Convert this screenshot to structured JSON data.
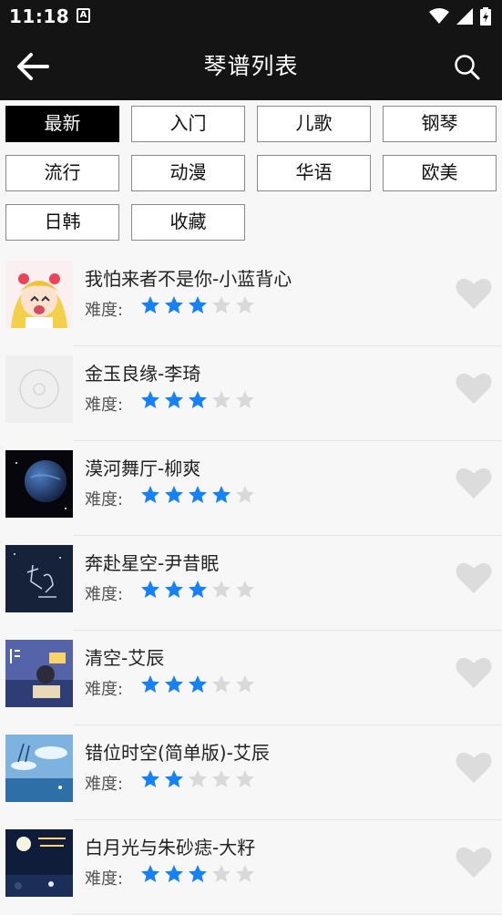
{
  "status": {
    "time": "11:18",
    "notif_icon": "A"
  },
  "appbar": {
    "title": "琴谱列表"
  },
  "chips": [
    {
      "label": "最新",
      "active": true
    },
    {
      "label": "入门",
      "active": false
    },
    {
      "label": "儿歌",
      "active": false
    },
    {
      "label": "钢琴",
      "active": false
    },
    {
      "label": "流行",
      "active": false
    },
    {
      "label": "动漫",
      "active": false
    },
    {
      "label": "华语",
      "active": false
    },
    {
      "label": "欧美",
      "active": false
    },
    {
      "label": "日韩",
      "active": false
    },
    {
      "label": "收藏",
      "active": false
    }
  ],
  "difficulty_label": "难度:",
  "colors": {
    "star_on": "#1682f6",
    "star_off": "#d9d9d9",
    "heart": "#dcdcdc",
    "bar": "#141414"
  },
  "songs": [
    {
      "title": "我怕来者不是你-小蓝背心",
      "rating": 3,
      "thumb": "anime-girl"
    },
    {
      "title": "金玉良缘-李琦",
      "rating": 3,
      "thumb": "disc-placeholder"
    },
    {
      "title": "漠河舞厅-柳爽",
      "rating": 4,
      "thumb": "planet"
    },
    {
      "title": "奔赴星空-尹昔眠",
      "rating": 3,
      "thumb": "night-text"
    },
    {
      "title": "清空-艾辰",
      "rating": 3,
      "thumb": "reading-boy"
    },
    {
      "title": "错位时空(简单版)-艾辰",
      "rating": 2,
      "thumb": "blue-sky"
    },
    {
      "title": "白月光与朱砂痣-大籽",
      "rating": 3,
      "thumb": "moon-night"
    }
  ]
}
